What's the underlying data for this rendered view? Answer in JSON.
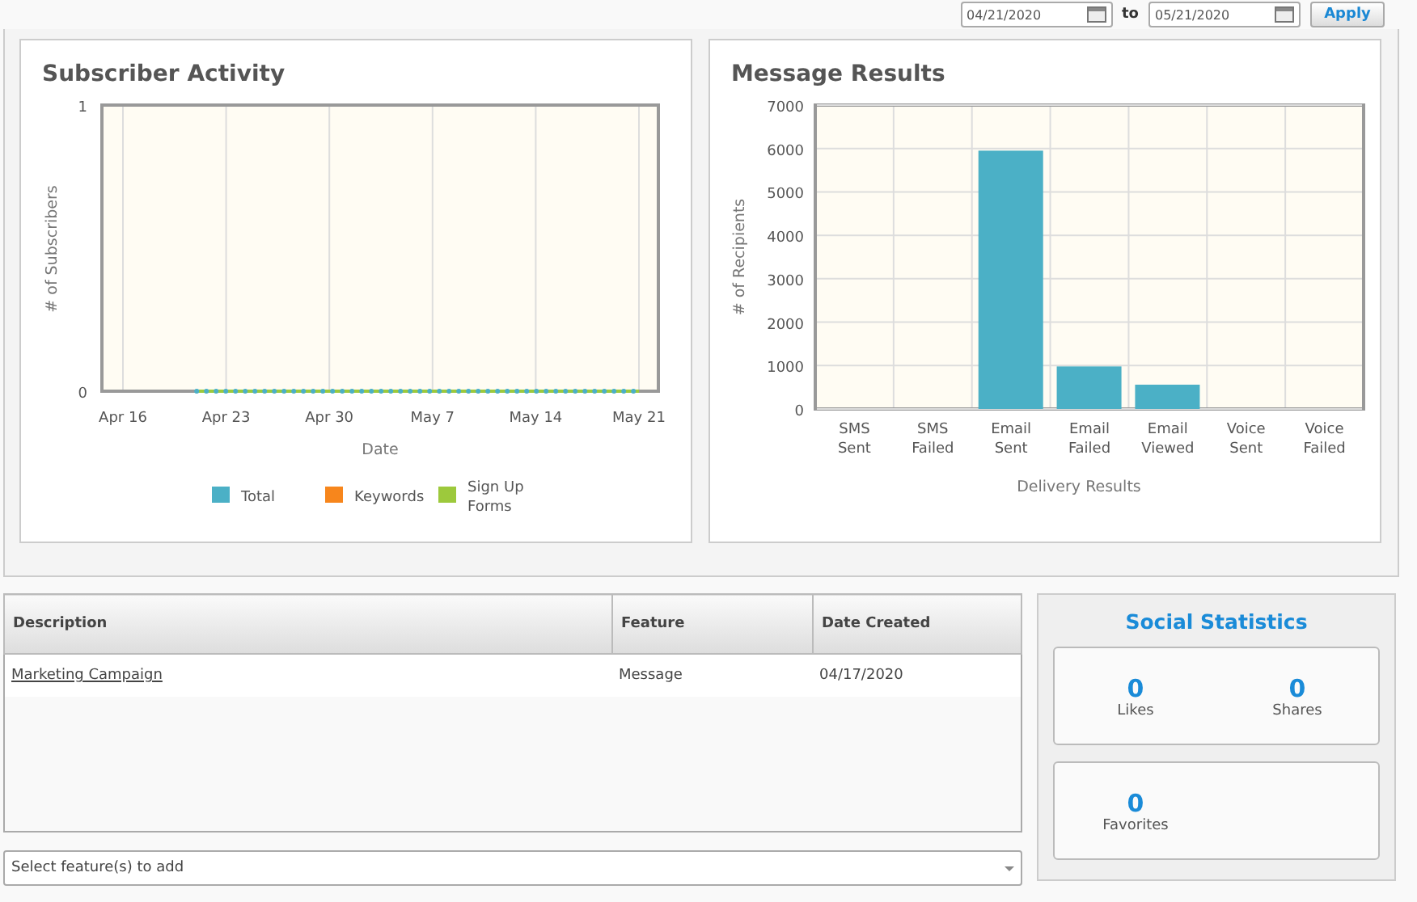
{
  "date_range": {
    "from": "04/21/2020",
    "separator": "to",
    "to": "05/21/2020",
    "apply_label": "Apply"
  },
  "subscriber_activity": {
    "title": "Subscriber Activity",
    "chart_data": {
      "type": "line",
      "xlabel": "Date",
      "ylabel": "# of Subscribers",
      "grid": true,
      "categories": [
        "Apr 16",
        null,
        null,
        null,
        null,
        null,
        null,
        "Apr 23",
        null,
        null,
        null,
        null,
        null,
        null,
        "Apr 30",
        null,
        null,
        null,
        null,
        null,
        null,
        "May 7",
        null,
        null,
        null,
        null,
        null,
        null,
        "May 14",
        null,
        null,
        null,
        null,
        null,
        null,
        "May 21"
      ],
      "series": [
        {
          "name": "Total",
          "color": "#4bb0c6",
          "line_style": "dotted",
          "values": [
            null,
            null,
            null,
            null,
            null,
            0,
            0,
            0,
            0,
            0,
            0,
            0,
            0,
            0,
            0,
            0,
            0,
            0,
            0,
            0,
            0,
            0,
            0,
            0,
            0,
            0,
            0,
            0,
            0,
            0,
            0,
            0,
            0,
            0,
            0,
            0
          ]
        },
        {
          "name": "Keywords",
          "color": "#f7861c",
          "values": [
            null,
            null,
            null,
            null,
            null,
            null,
            null,
            null,
            null,
            null,
            null,
            null,
            null,
            null,
            null,
            null,
            null,
            null,
            null,
            null,
            null,
            null,
            null,
            null,
            null,
            null,
            null,
            null,
            null,
            null,
            null,
            null,
            null,
            null,
            null,
            null
          ]
        },
        {
          "name": "Sign Up Forms",
          "color": "#9dc93c",
          "values": [
            null,
            null,
            null,
            null,
            null,
            0,
            0,
            0,
            0,
            0,
            0,
            0,
            0,
            0,
            0,
            0,
            0,
            0,
            0,
            0,
            0,
            0,
            0,
            0,
            0,
            0,
            0,
            0,
            0,
            0,
            0,
            0,
            0,
            0,
            0,
            0
          ]
        }
      ],
      "ylim": [
        0,
        1
      ],
      "yticks": [
        0,
        1
      ],
      "legend": true
    }
  },
  "message_results": {
    "title": "Message Results",
    "chart_data": {
      "type": "bar",
      "xlabel": "Delivery Results",
      "ylabel": "# of Recipients",
      "grid": true,
      "categories": [
        "SMS Sent",
        "SMS Failed",
        "Email Sent",
        "Email Failed",
        "Email Viewed",
        "Voice Sent",
        "Voice Failed"
      ],
      "series": [
        {
          "color": "#4bb0c6",
          "values": [
            0,
            0,
            5950,
            980,
            560,
            0,
            0
          ]
        }
      ],
      "ylim": [
        0,
        7000
      ],
      "yticks": [
        0,
        1000,
        2000,
        3000,
        4000,
        5000,
        6000,
        7000
      ]
    }
  },
  "table": {
    "columns": [
      "Description",
      "Feature",
      "Date Created"
    ],
    "rows": [
      {
        "description": "Marketing Campaign",
        "feature": "Message",
        "date_created": "04/17/2020"
      }
    ]
  },
  "feature_select": {
    "placeholder": "Select feature(s) to add"
  },
  "social_statistics": {
    "title": "Social Statistics",
    "cards": [
      [
        {
          "value": "0",
          "label": "Likes"
        },
        {
          "value": "0",
          "label": "Shares"
        }
      ],
      [
        {
          "value": "0",
          "label": "Favorites"
        }
      ]
    ]
  }
}
